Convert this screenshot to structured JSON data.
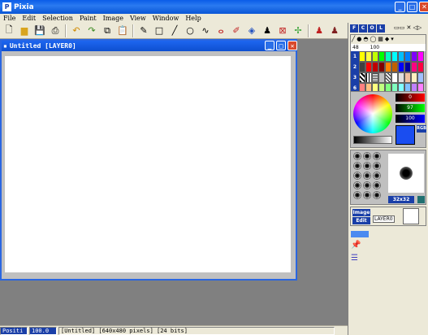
{
  "app": {
    "title": "Pixia"
  },
  "menu": [
    "File",
    "Edit",
    "Selection",
    "Paint",
    "Image",
    "View",
    "Window",
    "Help"
  ],
  "document": {
    "title": "Untitled [LAYER0]"
  },
  "status": {
    "position_label": "Positi",
    "zoom": "100.0",
    "info": "[Untitled] [640x480 pixels] [24 bits]"
  },
  "panel": {
    "top_tabs": [
      "F",
      "C",
      "O",
      "L"
    ],
    "color_values": {
      "r": "0",
      "g": "97",
      "b": "100"
    },
    "color_mode": "RGB",
    "brush_size": "32x32",
    "palette_rows": [
      "1",
      "2",
      "3",
      "6"
    ],
    "palette_labels": [
      "48",
      "100"
    ],
    "layer_buttons": {
      "image": "Image",
      "edit": "Edit"
    },
    "layer_name": "LAYER0"
  },
  "colors": {
    "accent": "#0a5ce8",
    "canvas": "#ffffff",
    "mdi_bg": "#808080",
    "current_color": "#1a4df0"
  }
}
